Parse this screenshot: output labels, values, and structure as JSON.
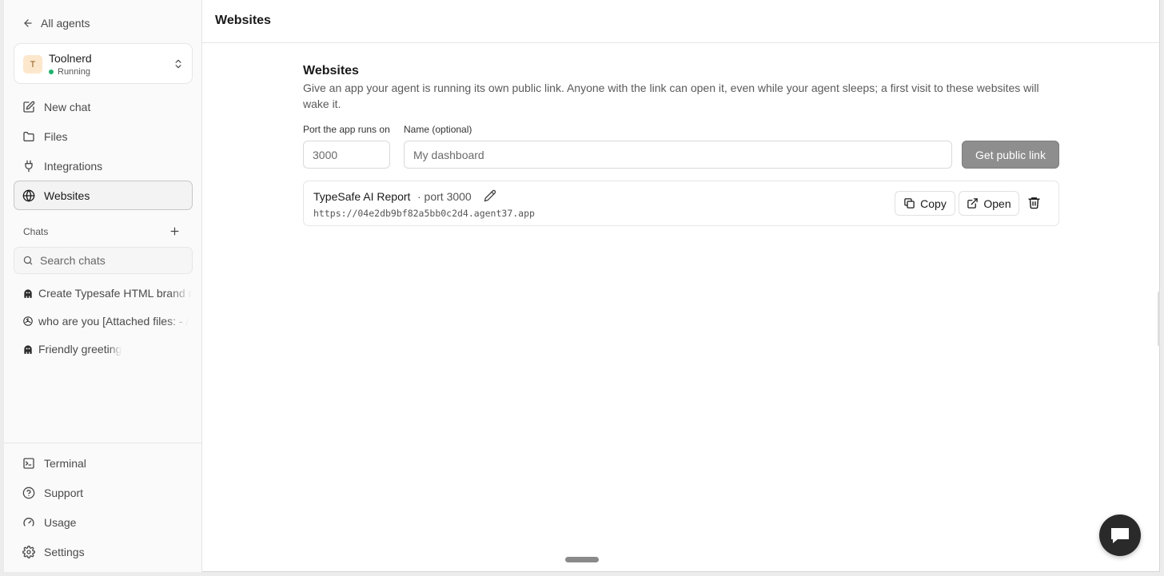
{
  "sidebar": {
    "back_label": "All agents",
    "agent": {
      "initial": "T",
      "name": "Toolnerd",
      "status": "Running",
      "status_color": "#1db36b"
    },
    "nav": [
      {
        "label": "New chat",
        "icon": "pencil-square-icon"
      },
      {
        "label": "Files",
        "icon": "folder-icon"
      },
      {
        "label": "Integrations",
        "icon": "plug-icon"
      },
      {
        "label": "Websites",
        "icon": "globe-icon",
        "active": true
      }
    ],
    "chats_label": "Chats",
    "search_placeholder": "Search chats",
    "chats": [
      {
        "label": "Create Typesafe HTML brand r",
        "icon": "agent-logo-icon"
      },
      {
        "label": "who are you [Attached files: - /",
        "icon": "openai-logo-icon"
      },
      {
        "label": "Friendly greeting",
        "icon": "agent-logo-icon"
      }
    ],
    "bottom_nav": [
      {
        "label": "Terminal",
        "icon": "terminal-icon"
      },
      {
        "label": "Support",
        "icon": "help-circle-icon"
      },
      {
        "label": "Usage",
        "icon": "gauge-icon"
      },
      {
        "label": "Settings",
        "icon": "gear-icon"
      }
    ]
  },
  "header": {
    "title": "Websites"
  },
  "websites": {
    "title": "Websites",
    "description": "Give an app your agent is running its own public link. Anyone with the link can open it, even while your agent sleeps; a first visit to these websites will wake it.",
    "port_label": "Port the app runs on",
    "port_placeholder": "3000",
    "name_label": "Name (optional)",
    "name_placeholder": "My dashboard",
    "submit_label": "Get public link",
    "sites": [
      {
        "name": "TypeSafe AI Report",
        "port": "· port 3000",
        "url": "https://04e2db9bf82a5bb0c2d4.agent37.app",
        "copy_label": "Copy",
        "open_label": "Open"
      }
    ]
  }
}
